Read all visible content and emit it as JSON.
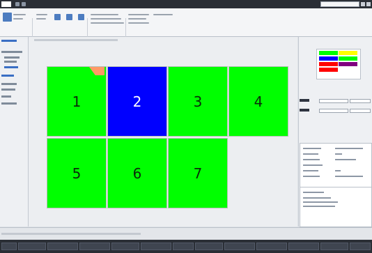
{
  "grid": {
    "cells": [
      {
        "label": "1",
        "color": "#00ff00"
      },
      {
        "label": "2",
        "color": "#0000ff"
      },
      {
        "label": "3",
        "color": "#00ff00"
      },
      {
        "label": "4",
        "color": "#00ff00"
      },
      {
        "label": "5",
        "color": "#00ff00"
      },
      {
        "label": "6",
        "color": "#00ff00"
      },
      {
        "label": "7",
        "color": "#00ff00"
      }
    ]
  },
  "color_swatches": [
    "#00ff00",
    "#ffff00",
    "#0000ff",
    "#00ff00",
    "#ff0000",
    "#800080",
    "#ff0000"
  ]
}
